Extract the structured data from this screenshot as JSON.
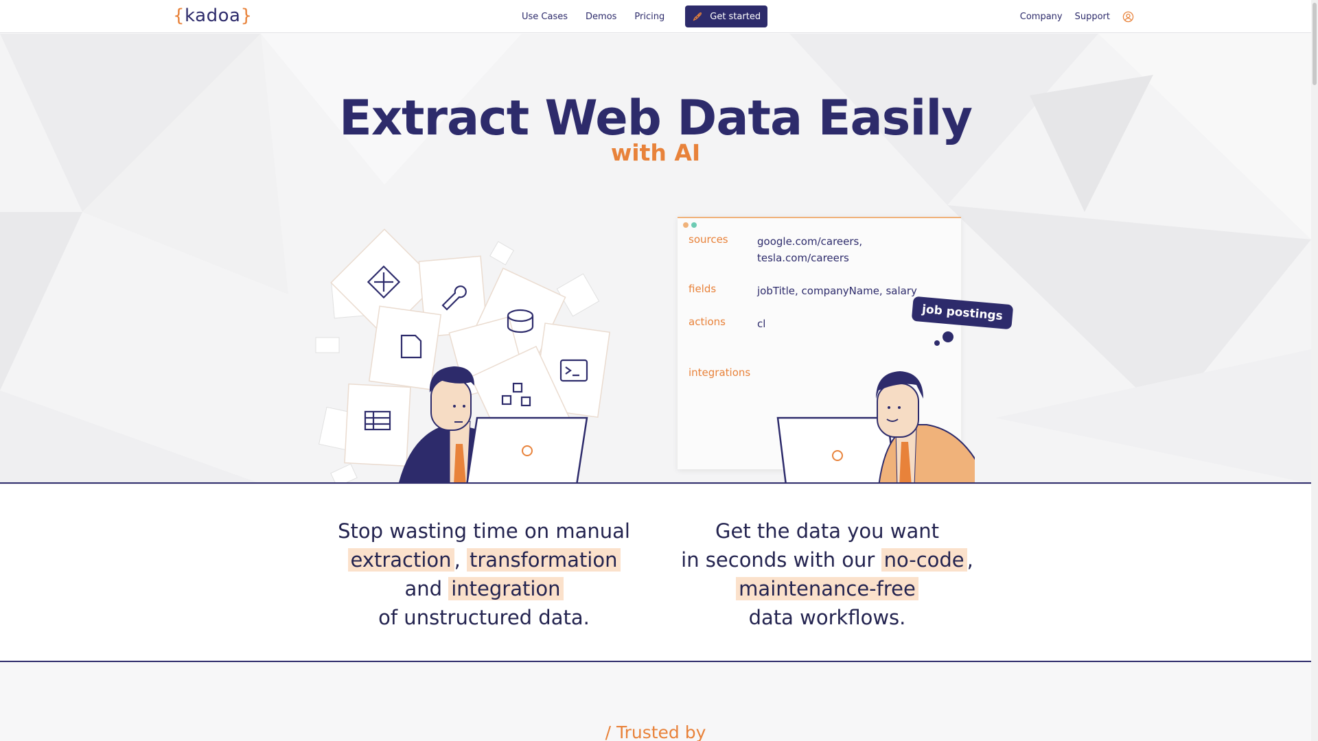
{
  "nav": {
    "logo": "kadoa",
    "links": [
      "Use Cases",
      "Demos",
      "Pricing"
    ],
    "cta_label": "Get started",
    "right_links": [
      "Company",
      "Support"
    ]
  },
  "hero": {
    "title": "Extract Web Data Easily",
    "subtitle": "with AI",
    "panel": {
      "sources_key": "sources",
      "sources_val1": "google.com/careers,",
      "sources_val2": "tesla.com/careers",
      "fields_key": "fields",
      "fields_val": "jobTitle, companyName, salary",
      "actions_key": "actions",
      "actions_val": "cl",
      "integrations_key": "integrations"
    },
    "bubble": "job postings"
  },
  "features": {
    "left": {
      "line1": "Stop wasting time on manual",
      "hl1": "extraction",
      "sep1": ",",
      "hl2": "transformation",
      "and": "and",
      "hl3": "integration",
      "line4": "of unstructured data."
    },
    "right": {
      "line1": "Get the data you want",
      "line2_pre": "in seconds with our",
      "hl1": "no-code",
      "sep1": ",",
      "hl2": "maintenance-free",
      "line4": "data workflows."
    }
  },
  "trusted": {
    "label": "/ Trusted by"
  },
  "colors": {
    "brand": "#2d2b6b",
    "accent": "#e8823a",
    "highlight": "#fbe1cb"
  }
}
